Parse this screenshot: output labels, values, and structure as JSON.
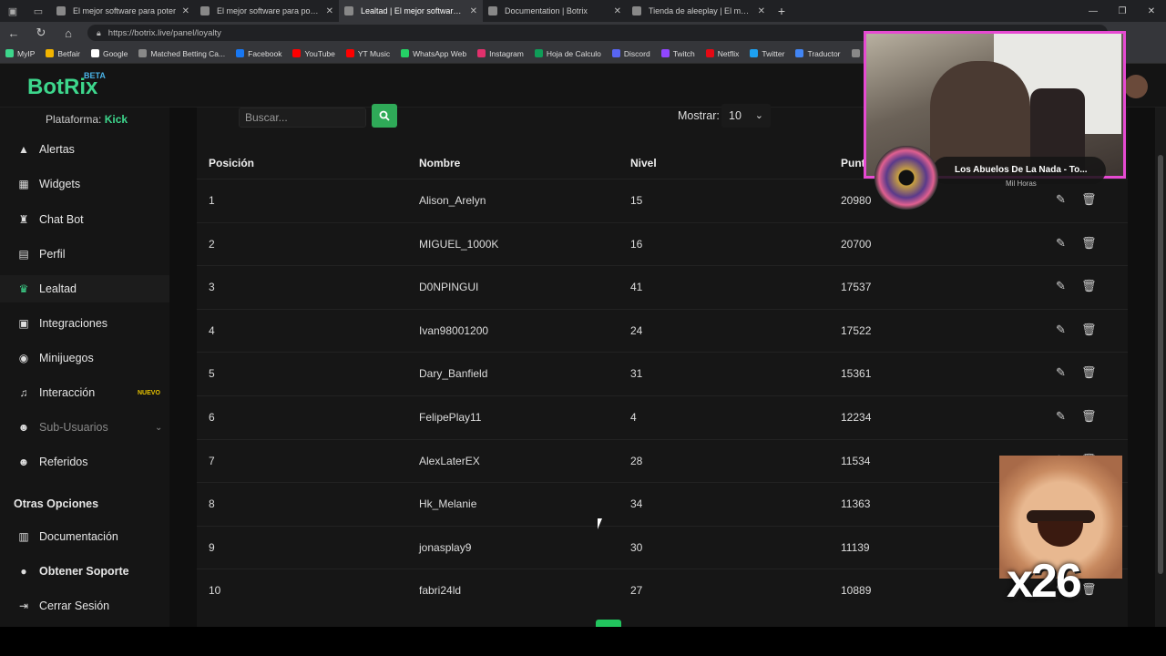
{
  "browser": {
    "tabs": [
      {
        "title": "El mejor software para poter",
        "active": false
      },
      {
        "title": "El mejor software para potenciar",
        "active": false
      },
      {
        "title": "Lealtad | El mejor software para p",
        "active": true
      },
      {
        "title": "Documentation | Botrix",
        "active": false
      },
      {
        "title": "Tienda de aleeplay | El mejor softw",
        "active": false
      }
    ],
    "url": "https://botrix.live/panel/loyalty",
    "bookmarks": [
      {
        "label": "MyIP",
        "color": "#3dd68c"
      },
      {
        "label": "Betfair",
        "color": "#f2b400"
      },
      {
        "label": "Google",
        "color": "#ffffff"
      },
      {
        "label": "Matched Betting Ca...",
        "color": "#888888"
      },
      {
        "label": "Facebook",
        "color": "#1877f2"
      },
      {
        "label": "YouTube",
        "color": "#ff0000"
      },
      {
        "label": "YT Music",
        "color": "#ff0000"
      },
      {
        "label": "WhatsApp Web",
        "color": "#25d366"
      },
      {
        "label": "Instagram",
        "color": "#e1306c"
      },
      {
        "label": "Hoja de Calculo",
        "color": "#0f9d58"
      },
      {
        "label": "Discord",
        "color": "#5865f2"
      },
      {
        "label": "Twitch",
        "color": "#9146ff"
      },
      {
        "label": "Netflix",
        "color": "#e50914"
      },
      {
        "label": "Twitter",
        "color": "#1da1f2"
      },
      {
        "label": "Traductor",
        "color": "#4285f4"
      },
      {
        "label": "Cinepl",
        "color": "#888888"
      }
    ]
  },
  "header": {
    "logo": "BotRix",
    "beta": "BETA"
  },
  "sidebar": {
    "platform_label": "Plataforma:",
    "platform_value": "Kick",
    "items": [
      {
        "label": "Alertas",
        "icon": "warning-icon"
      },
      {
        "label": "Widgets",
        "icon": "grid-icon"
      },
      {
        "label": "Chat Bot",
        "icon": "robot-icon"
      },
      {
        "label": "Perfil",
        "icon": "id-card-icon"
      },
      {
        "label": "Lealtad",
        "icon": "trophy-icon",
        "active": true
      },
      {
        "label": "Integraciones",
        "icon": "plug-icon"
      },
      {
        "label": "Minijuegos",
        "icon": "gamepad-icon"
      },
      {
        "label": "Interacción",
        "icon": "music-icon",
        "badge": "NUEVO"
      },
      {
        "label": "Sub-Usuarios",
        "icon": "users-icon",
        "dim": true
      },
      {
        "label": "Referidos",
        "icon": "user-friends-icon"
      }
    ],
    "other_title": "Otras Opciones",
    "other_items": [
      {
        "label": "Documentación",
        "icon": "book-icon"
      },
      {
        "label": "Obtener Soporte",
        "icon": "question-icon"
      },
      {
        "label": "Cerrar Sesión",
        "icon": "logout-icon"
      }
    ]
  },
  "toolbar": {
    "search_placeholder": "Buscar...",
    "show_label": "Mostrar:",
    "show_value": "10"
  },
  "table": {
    "headers": [
      "Posición",
      "Nombre",
      "Nivel",
      "Puntos"
    ],
    "rows": [
      {
        "pos": "1",
        "name": "Alison_Arelyn",
        "level": "15",
        "points": "20980"
      },
      {
        "pos": "2",
        "name": "MIGUEL_1000K",
        "level": "16",
        "points": "20700"
      },
      {
        "pos": "3",
        "name": "D0NPINGUI",
        "level": "41",
        "points": "17537"
      },
      {
        "pos": "4",
        "name": "Ivan98001200",
        "level": "24",
        "points": "17522"
      },
      {
        "pos": "5",
        "name": "Dary_Banfield",
        "level": "31",
        "points": "15361"
      },
      {
        "pos": "6",
        "name": "FelipePlay11",
        "level": "4",
        "points": "12234"
      },
      {
        "pos": "7",
        "name": "AlexLaterEX",
        "level": "28",
        "points": "11534"
      },
      {
        "pos": "8",
        "name": "Hk_Melanie",
        "level": "34",
        "points": "11363"
      },
      {
        "pos": "9",
        "name": "jonasplay9",
        "level": "30",
        "points": "11139"
      },
      {
        "pos": "10",
        "name": "fabri24ld",
        "level": "27",
        "points": "10889"
      }
    ]
  },
  "overlay": {
    "song": "Los Abuelos De La Nada - To...",
    "artist": "Mil Horas",
    "reaction_count": "x26"
  }
}
